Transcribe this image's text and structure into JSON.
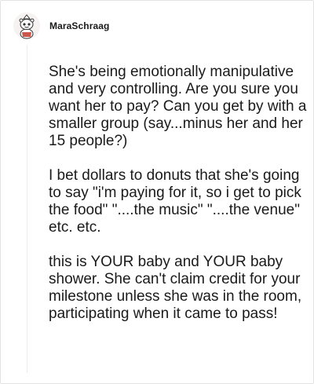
{
  "comment": {
    "username": "MaraSchraag",
    "paragraphs": [
      "She's being emotionally manipulative and very controlling. Are you sure you want her to pay? Can you get by with a smaller group (say...minus her and her 15 people?)",
      "I bet dollars to donuts that she's going to say \"i'm paying for it, so i get to pick the food\" \"....the music\" \"....the venue\" etc. etc.",
      "this is YOUR baby and YOUR baby shower. She can't claim credit for your milestone unless she was in the room, participating when it came to pass!"
    ]
  },
  "icons": {
    "avatar": "snoo-avatar-icon"
  },
  "colors": {
    "text": "#1a1a1b",
    "border": "#e3e3e3",
    "thread_line": "#ececec"
  }
}
